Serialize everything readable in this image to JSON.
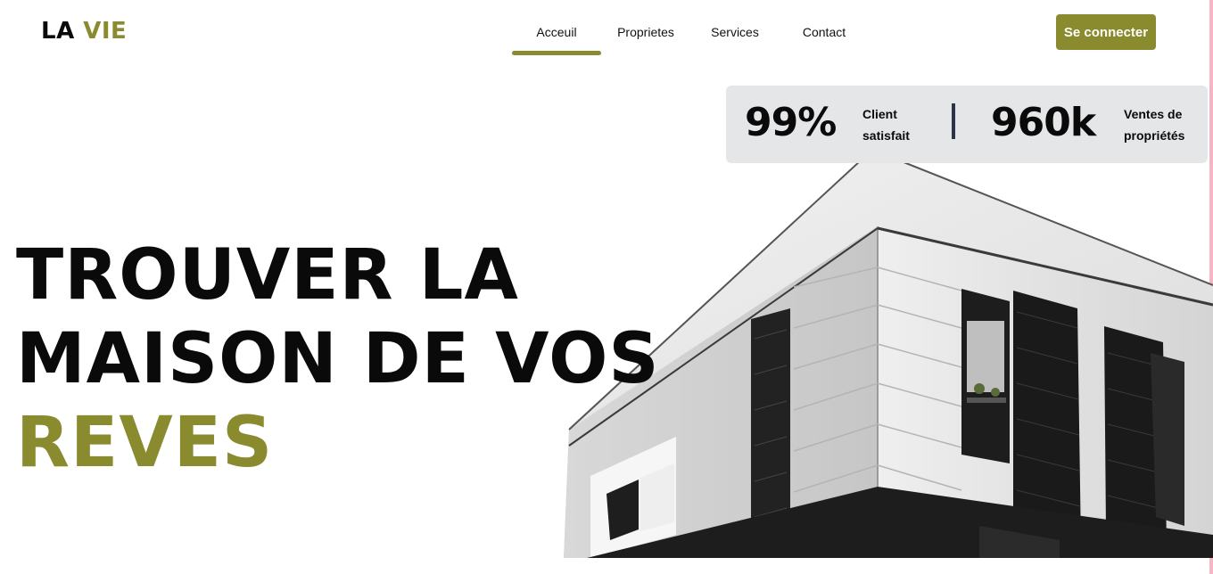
{
  "brand": {
    "part1": "LA",
    "part2": "VIE",
    "accent_color": "#8a8a2e"
  },
  "nav": {
    "items": [
      {
        "label": "Acceuil",
        "active": true
      },
      {
        "label": "Proprietes",
        "active": false
      },
      {
        "label": "Services",
        "active": false
      },
      {
        "label": "Contact",
        "active": false
      }
    ]
  },
  "login_button": {
    "label": "Se connecter"
  },
  "stats": {
    "satisfaction": {
      "value": "99%",
      "label_line1": "Client",
      "label_line2": "satisfait"
    },
    "sales": {
      "value": "960k",
      "label_line1": "Ventes de",
      "label_line2": "propriétés"
    }
  },
  "hero": {
    "line1": "TROUVER LA",
    "line2": "MAISON DE VOS",
    "line3": "REVES"
  },
  "image": {
    "name": "modern-white-building-photo"
  }
}
